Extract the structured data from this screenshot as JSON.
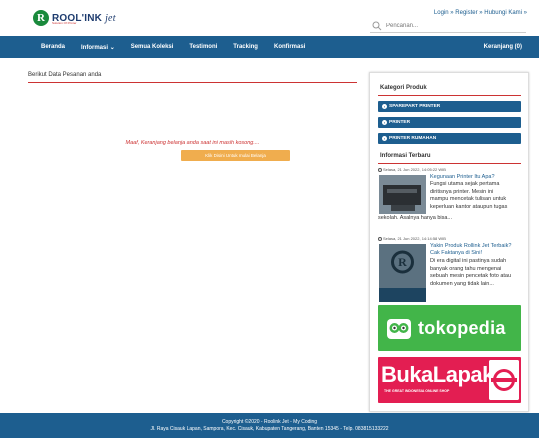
{
  "header": {
    "logo_letter": "R",
    "logo_name": "ROOL'INK",
    "logo_suffix": "jet",
    "logo_tagline": "Solution Of Printer",
    "top_links": [
      "Login",
      "Register",
      "Hubungi Kami"
    ],
    "search_placeholder": "Pencarian..."
  },
  "nav": {
    "items": [
      "Beranda",
      "Informasi ⌄",
      "Semua Koleksi",
      "Testimoni",
      "Tracking",
      "Konfirmasi"
    ],
    "cart": "Keranjang (0)"
  },
  "main": {
    "title": "Berikut Data Pesanan anda",
    "empty_message": "Maaf, Keranjang belanja anda saat ini masih kosong....",
    "empty_button": "Klik Disini Untuk mulai Belanja"
  },
  "sidebar": {
    "category_title": "Kategori Produk",
    "categories": [
      "SPAREPART PRINTER",
      "PRINTER",
      "PRINTER RUMAHAN"
    ],
    "news_title": "Informasi Terbaru",
    "posts": [
      {
        "date": "Selasa, 21 Jun 2022, 14:05:22 WIB",
        "title": "Kegunaan Printer Itu Apa?",
        "excerpt_right": [
          "Fungsi utama sejak pertama",
          "diritisnya printer. Mesin ini",
          "mampu mencetak tulisan untuk",
          "keperluan kantor ataupun tugas"
        ],
        "excerpt_full": "sekolah. Asalnya hanya bisa..."
      },
      {
        "date": "Selasa, 21 Jun 2022, 14:14:58 WIB",
        "title_lines": [
          "Yakin Produk Rollink Jet Terbaik?",
          "Cak Faktanya di Sini!"
        ],
        "excerpt_right": [
          "Di era digital ini pastinya sudah",
          "banyak orang tahu mengenai",
          "sebuah mesin pencetak foto atau",
          "dokumen yang tidak lain..."
        ]
      }
    ],
    "tokopedia_label": "tokopedia",
    "bukalapak_label": "BukaLapak",
    "bukalapak_tagline": "THE GREAT INDONESIA ONLINE SHOP"
  },
  "footer": {
    "copyright": "Copyright ©2020 - Roolink Jet - My Coding",
    "address": "Jl. Raya Cisauk Lapan, Sampora, Kec. Cisauk, Kabupaten Tangerang, Banten 15345 - Telp. 083815133222"
  },
  "colors": {
    "primary": "#1d5e8f",
    "accent_red": "#cc3333",
    "button_orange": "#f0ad4e",
    "tokopedia_green": "#42b549",
    "bukalapak_red": "#e31e52"
  }
}
